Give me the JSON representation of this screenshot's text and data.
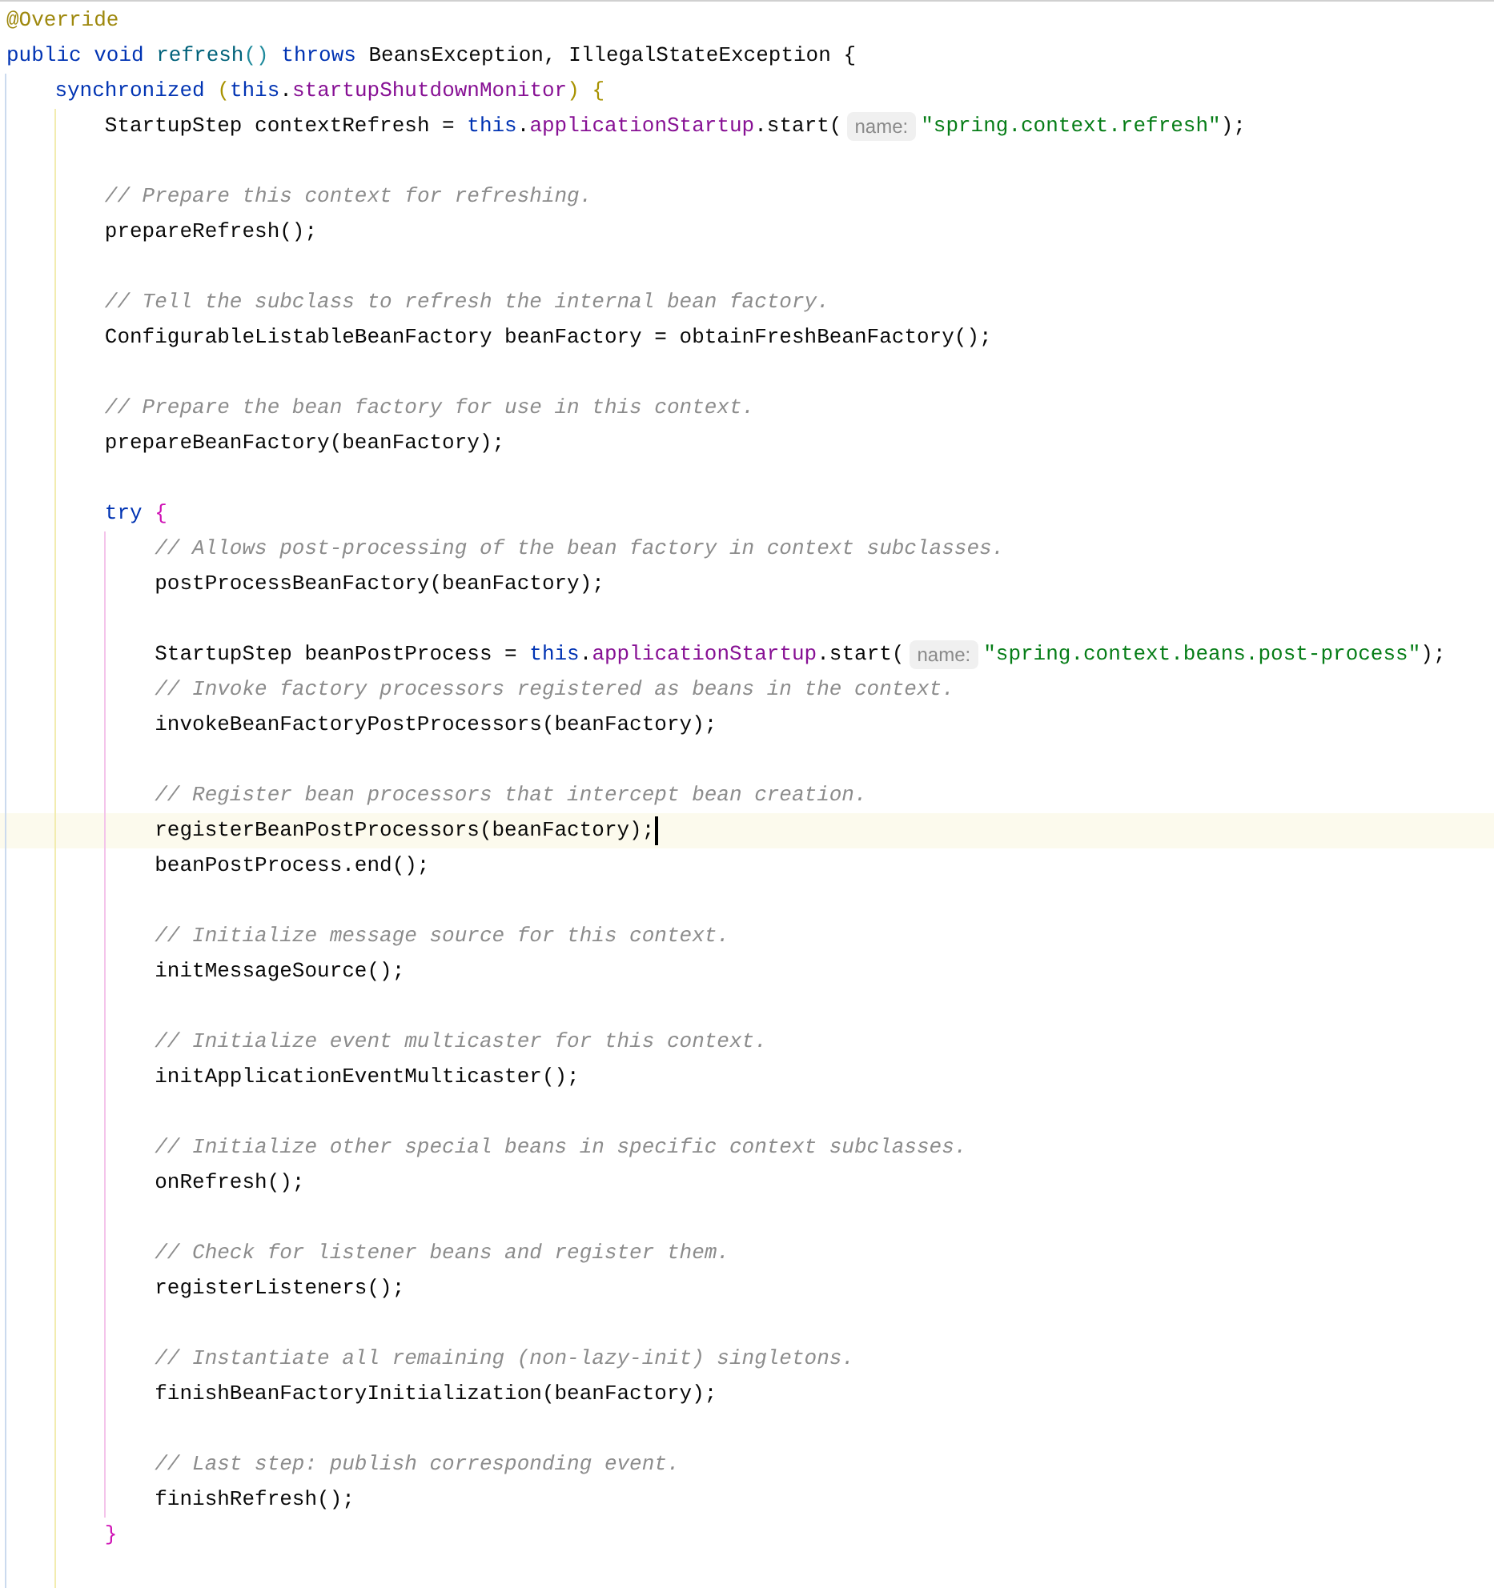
{
  "editor": {
    "lines": [
      {
        "current": false,
        "tokens": [
          {
            "kind": "annotation",
            "text": "@Override"
          }
        ]
      },
      {
        "current": false,
        "tokens": [
          {
            "kind": "keyword",
            "text": "public "
          },
          {
            "kind": "keyword",
            "text": "void "
          },
          {
            "kind": "declaration",
            "text": "refresh"
          },
          {
            "kind": "bracket0",
            "text": "() "
          },
          {
            "kind": "keyword",
            "text": "throws"
          },
          {
            "kind": "plain",
            "text": " BeansException, IllegalStateException {"
          }
        ],
        "children": [
          {
            "current": false,
            "tokens": [
              {
                "kind": "keyword",
                "text": "synchronized "
              },
              {
                "kind": "bracket1",
                "text": "("
              },
              {
                "kind": "keyword",
                "text": "this"
              },
              {
                "kind": "plain",
                "text": "."
              },
              {
                "kind": "field",
                "text": "startupShutdownMonitor"
              },
              {
                "kind": "bracket1",
                "text": ") {"
              }
            ],
            "children": [
              {
                "current": false,
                "tokens": [
                  {
                    "kind": "plain",
                    "text": "StartupStep contextRefresh = "
                  },
                  {
                    "kind": "keyword",
                    "text": "this"
                  },
                  {
                    "kind": "plain",
                    "text": "."
                  },
                  {
                    "kind": "field",
                    "text": "applicationStartup"
                  },
                  {
                    "kind": "plain",
                    "text": ".start("
                  },
                  {
                    "kind": "hint",
                    "text": "name:"
                  },
                  {
                    "kind": "string",
                    "text": "\"spring.context.refresh\""
                  },
                  {
                    "kind": "plain",
                    "text": ");"
                  }
                ]
              },
              {
                "current": false
              },
              {
                "current": false,
                "tokens": [
                  {
                    "kind": "comment",
                    "text": "// Prepare this context for refreshing."
                  }
                ]
              },
              {
                "current": false,
                "tokens": [
                  {
                    "kind": "plain",
                    "text": "prepareRefresh();"
                  }
                ]
              },
              {
                "current": false
              },
              {
                "current": false,
                "tokens": [
                  {
                    "kind": "comment",
                    "text": "// Tell the subclass to refresh the internal bean factory."
                  }
                ]
              },
              {
                "current": false,
                "tokens": [
                  {
                    "kind": "plain",
                    "text": "ConfigurableListableBeanFactory beanFactory = obtainFreshBeanFactory();"
                  }
                ]
              },
              {
                "current": false
              },
              {
                "current": false,
                "tokens": [
                  {
                    "kind": "comment",
                    "text": "// Prepare the bean factory for use in this context."
                  }
                ]
              },
              {
                "current": false,
                "tokens": [
                  {
                    "kind": "plain",
                    "text": "prepareBeanFactory(beanFactory);"
                  }
                ]
              },
              {
                "current": false
              },
              {
                "current": false,
                "tokens": [
                  {
                    "kind": "keyword",
                    "text": "try "
                  },
                  {
                    "kind": "bracket2",
                    "text": "{"
                  }
                ],
                "children": [
                  {
                    "current": false,
                    "tokens": [
                      {
                        "kind": "comment",
                        "text": "// Allows post-processing of the bean factory in context subclasses."
                      }
                    ]
                  },
                  {
                    "current": false,
                    "tokens": [
                      {
                        "kind": "plain",
                        "text": "postProcessBeanFactory(beanFactory);"
                      }
                    ]
                  },
                  {
                    "current": false
                  },
                  {
                    "current": false,
                    "tokens": [
                      {
                        "kind": "plain",
                        "text": "StartupStep beanPostProcess = "
                      },
                      {
                        "kind": "keyword",
                        "text": "this"
                      },
                      {
                        "kind": "plain",
                        "text": "."
                      },
                      {
                        "kind": "field",
                        "text": "applicationStartup"
                      },
                      {
                        "kind": "plain",
                        "text": ".start("
                      },
                      {
                        "kind": "hint",
                        "text": "name:"
                      },
                      {
                        "kind": "string",
                        "text": "\"spring.context.beans.post-process\""
                      },
                      {
                        "kind": "plain",
                        "text": ");"
                      }
                    ]
                  },
                  {
                    "current": false,
                    "tokens": [
                      {
                        "kind": "comment",
                        "text": "// Invoke factory processors registered as beans in the context."
                      }
                    ]
                  },
                  {
                    "current": false,
                    "tokens": [
                      {
                        "kind": "plain",
                        "text": "invokeBeanFactoryPostProcessors(beanFactory);"
                      }
                    ]
                  },
                  {
                    "current": false
                  },
                  {
                    "current": false,
                    "tokens": [
                      {
                        "kind": "comment",
                        "text": "// Register bean processors that intercept bean creation."
                      }
                    ]
                  },
                  {
                    "current": true,
                    "tokens": [
                      {
                        "kind": "plain",
                        "text": "registerBeanPostProcessors(beanFactory);"
                      }
                    ]
                  },
                  {
                    "current": false,
                    "tokens": [
                      {
                        "kind": "plain",
                        "text": "beanPostProcess.end();"
                      }
                    ]
                  },
                  {
                    "current": false
                  },
                  {
                    "current": false,
                    "tokens": [
                      {
                        "kind": "comment",
                        "text": "// Initialize message source for this context."
                      }
                    ]
                  },
                  {
                    "current": false,
                    "tokens": [
                      {
                        "kind": "plain",
                        "text": "initMessageSource();"
                      }
                    ]
                  },
                  {
                    "current": false
                  },
                  {
                    "current": false,
                    "tokens": [
                      {
                        "kind": "comment",
                        "text": "// Initialize event multicaster for this context."
                      }
                    ]
                  },
                  {
                    "current": false,
                    "tokens": [
                      {
                        "kind": "plain",
                        "text": "initApplicationEventMulticaster();"
                      }
                    ]
                  },
                  {
                    "current": false
                  },
                  {
                    "current": false,
                    "tokens": [
                      {
                        "kind": "comment",
                        "text": "// Initialize other special beans in specific context subclasses."
                      }
                    ]
                  },
                  {
                    "current": false,
                    "tokens": [
                      {
                        "kind": "plain",
                        "text": "onRefresh();"
                      }
                    ]
                  },
                  {
                    "current": false
                  },
                  {
                    "current": false,
                    "tokens": [
                      {
                        "kind": "comment",
                        "text": "// Check for listener beans and register them."
                      }
                    ]
                  },
                  {
                    "current": false,
                    "tokens": [
                      {
                        "kind": "plain",
                        "text": "registerListeners();"
                      }
                    ]
                  },
                  {
                    "current": false
                  },
                  {
                    "current": false,
                    "tokens": [
                      {
                        "kind": "comment",
                        "text": "// Instantiate all remaining (non-lazy-init) singletons."
                      }
                    ]
                  },
                  {
                    "current": false,
                    "tokens": [
                      {
                        "kind": "plain",
                        "text": "finishBeanFactoryInitialization(beanFactory);"
                      }
                    ]
                  },
                  {
                    "current": false
                  },
                  {
                    "current": false,
                    "tokens": [
                      {
                        "kind": "comment",
                        "text": "// Last step: publish corresponding event."
                      }
                    ]
                  },
                  {
                    "current": false,
                    "tokens": [
                      {
                        "kind": "plain",
                        "text": "finishRefresh();"
                      }
                    ]
                  }
                ]
              },
              {
                "current": false,
                "tokens": [
                  {
                    "kind": "bracket2",
                    "text": "}"
                  }
                ]
              },
              {
                "current": false
              }
            ]
          }
        ]
      }
    ]
  }
}
